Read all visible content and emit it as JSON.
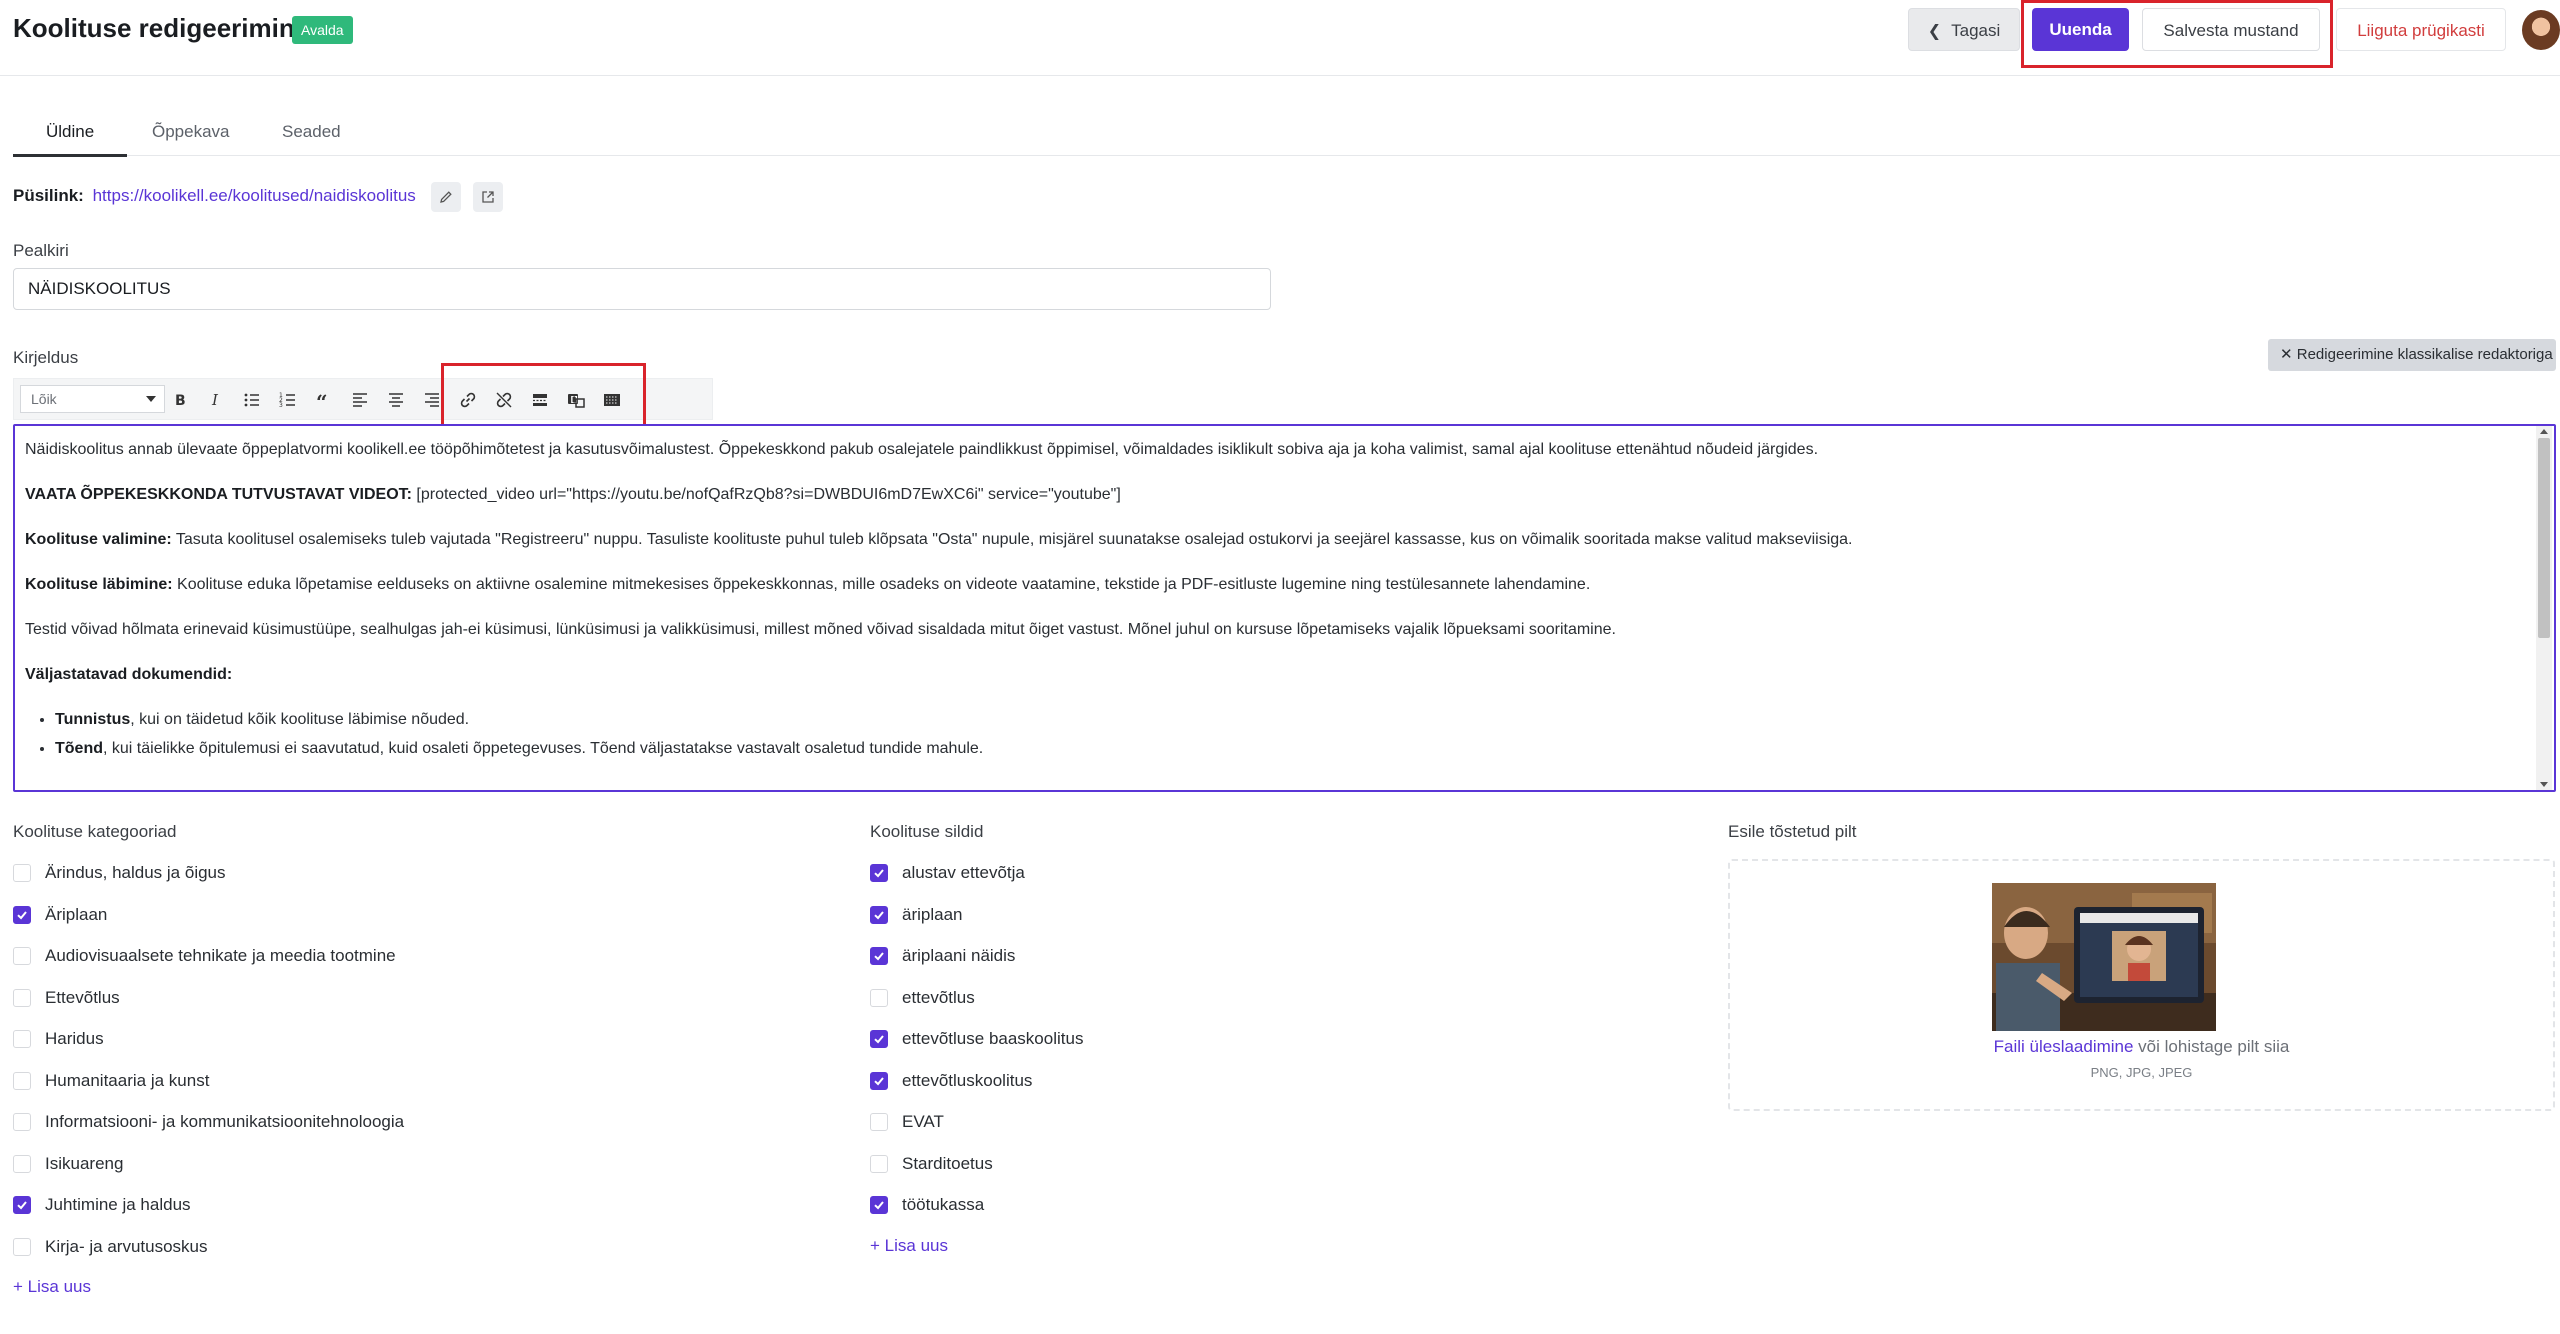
{
  "header": {
    "title": "Koolituse redigeerimine",
    "status_badge": "Avalda",
    "back_label": "Tagasi",
    "update_label": "Uuenda",
    "save_draft_label": "Salvesta mustand",
    "trash_label": "Liiguta prügikasti"
  },
  "tabs": [
    "Üldine",
    "Õppekava",
    "Seaded"
  ],
  "permalink": {
    "label": "Püsilink:",
    "url": "https://koolikell.ee/koolitused/naidiskoolitus"
  },
  "title_field": {
    "label": "Pealkiri",
    "value": "NÄIDISKOOLITUS"
  },
  "description": {
    "label": "Kirjeldus",
    "classic_editor_button": "Redigeerimine klassikalise redaktoriga",
    "format_select": "Lõik",
    "paragraphs": {
      "p1": "Näidiskoolitus annab ülevaate õppeplatvormi koolikell.ee tööpõhimõtetest ja kasutusvõimalustest. Õppekeskkond pakub osalejatele paindlikkust õppimisel, võimaldades isiklikult sobiva aja ja koha valimist, samal ajal koolituse ettenähtud nõudeid järgides.",
      "p2_bold": "VAATA ÕPPEKESKKONDA TUTVUSTAVAT VIDEOT:",
      "p2_text": " [protected_video url=\"https://youtu.be/nofQafRzQb8?si=DWBDUI6mD7EwXC6i\" service=\"youtube\"]",
      "p3_bold": "Koolituse valimine:",
      "p3_text": " Tasuta koolitusel osalemiseks tuleb vajutada \"Registreeru\" nuppu. Tasuliste koolituste puhul tuleb klõpsata \"Osta\" nupule, misjärel suunatakse osalejad ostukorvi ja seejärel kassasse, kus on võimalik sooritada makse valitud makseviisiga.",
      "p4_bold": "Koolituse läbimine:",
      "p4_text": " Koolituse eduka lõpetamise eelduseks on aktiivne osalemine mitmekesises õppekeskkonnas, mille osadeks on videote vaatamine, tekstide ja PDF-esitluste lugemine ning testülesannete lahendamine.",
      "p5": "Testid võivad hõlmata erinevaid küsimustüüpe, sealhulgas jah-ei küsimusi, lünküsimusi ja valikküsimusi, millest mõned võivad sisaldada mitut õiget vastust. Mõnel juhul on kursuse lõpetamiseks vajalik lõpueksami sooritamine.",
      "p6_bold": "Väljastatavad dokumendid:",
      "li1_bold": "Tunnistus",
      "li1_text": ", kui on täidetud kõik koolituse läbimise nõuded.",
      "li2_bold": "Tõend",
      "li2_text": ", kui täielikke õpitulemusi ei saavutatud, kuid osaleti õppetegevuses. Tõend väljastatakse vastavalt osaletud tundide mahule."
    }
  },
  "categories": {
    "title": "Koolituse kategooriad",
    "items": [
      {
        "label": "Ärindus, haldus ja õigus",
        "checked": false
      },
      {
        "label": "Äriplaan",
        "checked": true
      },
      {
        "label": "Audiovisuaalsete tehnikate ja meedia tootmine",
        "checked": false
      },
      {
        "label": "Ettevõtlus",
        "checked": false
      },
      {
        "label": "Haridus",
        "checked": false
      },
      {
        "label": "Humanitaaria ja kunst",
        "checked": false
      },
      {
        "label": "Informatsiooni- ja kommunikatsioonitehnoloogia",
        "checked": false
      },
      {
        "label": "Isikuareng",
        "checked": false
      },
      {
        "label": "Juhtimine ja haldus",
        "checked": true
      },
      {
        "label": "Kirja- ja arvutusoskus",
        "checked": false
      }
    ],
    "add_label": "Lisa uus"
  },
  "tags": {
    "title": "Koolituse sildid",
    "items": [
      {
        "label": "alustav ettevõtja",
        "checked": true
      },
      {
        "label": "äriplaan",
        "checked": true
      },
      {
        "label": "äriplaani näidis",
        "checked": true
      },
      {
        "label": "ettevõtlus",
        "checked": false
      },
      {
        "label": "ettevõtluse baaskoolitus",
        "checked": true
      },
      {
        "label": "ettevõtluskoolitus",
        "checked": true
      },
      {
        "label": "EVAT",
        "checked": false
      },
      {
        "label": "Starditoetus",
        "checked": false
      },
      {
        "label": "töötukassa",
        "checked": true
      }
    ],
    "add_label": "Lisa uus"
  },
  "featured_image": {
    "title": "Esile tõstetud pilt",
    "upload_link": "Faili üleslaadimine",
    "upload_text": " või lohistage pilt siia",
    "formats": "PNG, JPG, JPEG"
  },
  "colors": {
    "accent": "#5a35d6",
    "badge": "#2fb97b",
    "danger": "#d13d3d",
    "highlight": "#d9232b"
  }
}
